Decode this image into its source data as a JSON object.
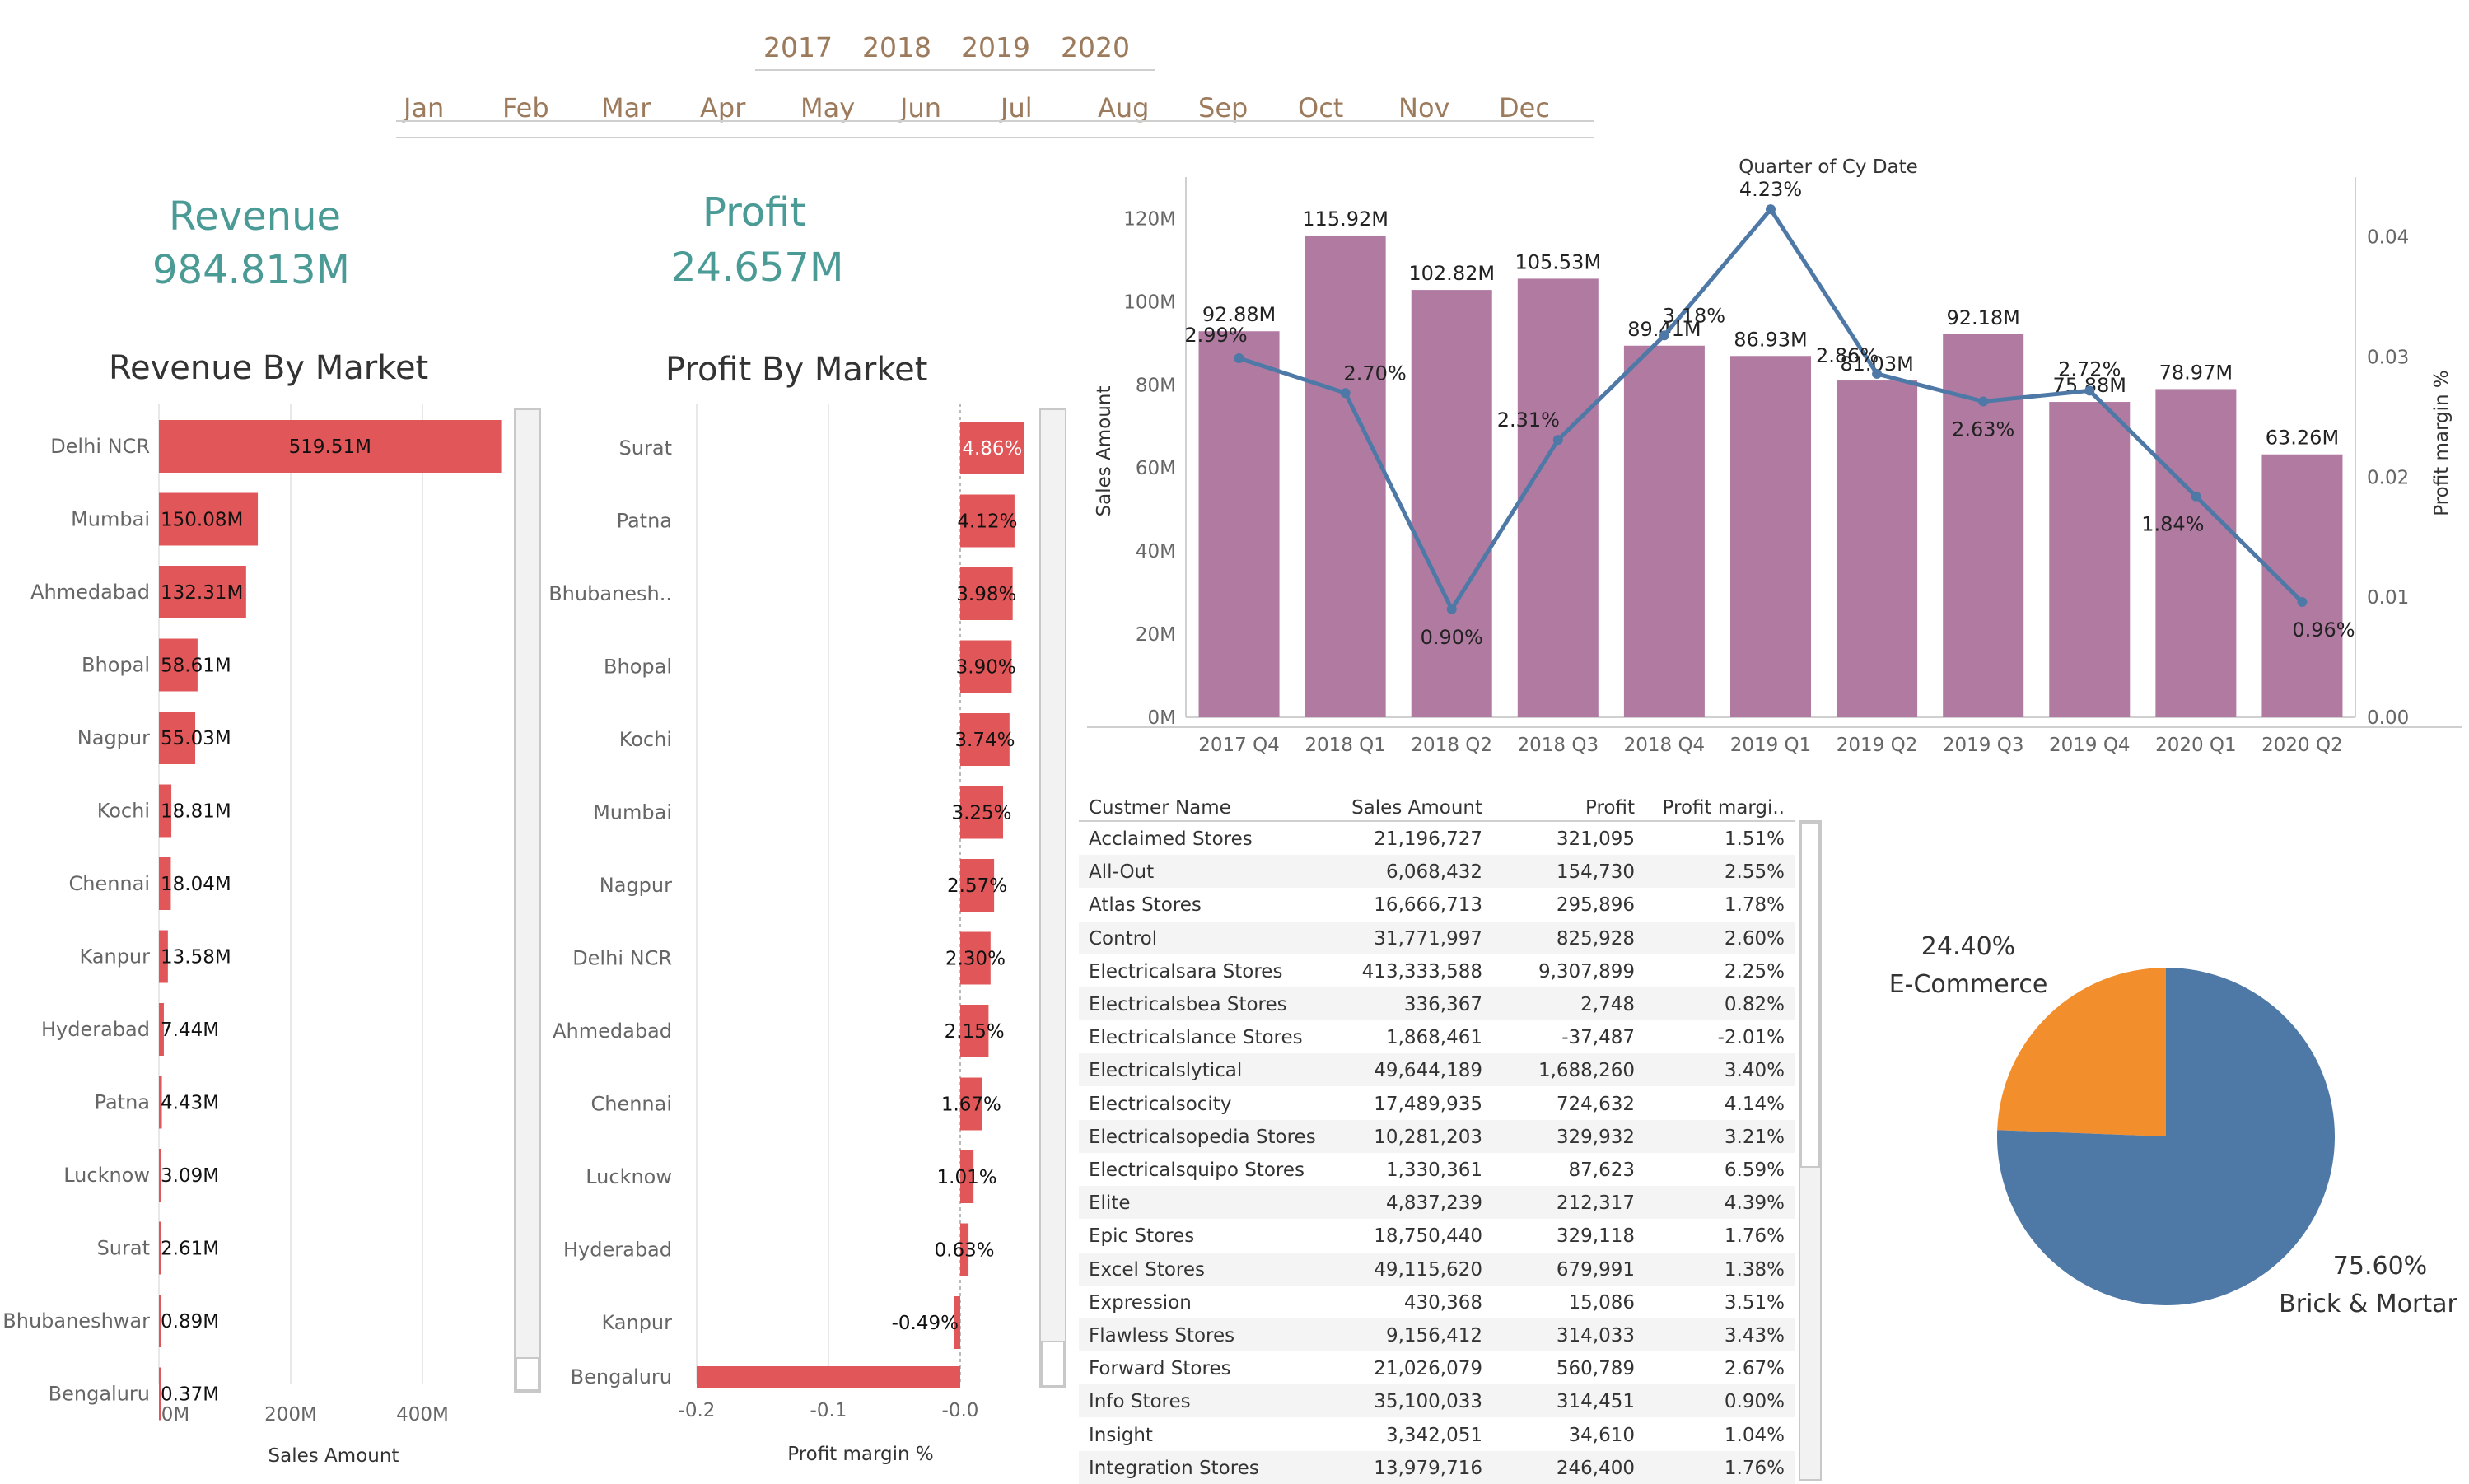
{
  "filters": {
    "years": [
      "2017",
      "2018",
      "2019",
      "2020"
    ],
    "months": [
      "Jan",
      "Feb",
      "Mar",
      "Apr",
      "May",
      "Jun",
      "Jul",
      "Aug",
      "Sep",
      "Oct",
      "Nov",
      "Dec"
    ]
  },
  "kpis": {
    "revenue_label": "Revenue",
    "revenue_value": "984.813M",
    "profit_label": "Profit",
    "profit_value": "24.657M"
  },
  "colors": {
    "bar_red": "#e15759",
    "bar_purple": "#b07aa1",
    "line_blue": "#4e79a7",
    "pie_orange": "#f28e2b",
    "pie_blue": "#4e79a7",
    "kpi_teal": "#4a9a96"
  },
  "chart_data": [
    {
      "type": "bar",
      "title": "Revenue By Market",
      "xlabel": "Sales Amount",
      "orientation": "horizontal",
      "categories": [
        "Delhi NCR",
        "Mumbai",
        "Ahmedabad",
        "Bhopal",
        "Nagpur",
        "Kochi",
        "Chennai",
        "Kanpur",
        "Hyderabad",
        "Patna",
        "Lucknow",
        "Surat",
        "Bhubaneshwar",
        "Bengaluru"
      ],
      "values": [
        519.51,
        150.08,
        132.31,
        58.61,
        55.03,
        18.81,
        18.04,
        13.58,
        7.44,
        4.43,
        3.09,
        2.61,
        0.89,
        0.37
      ],
      "labels": [
        "519.51M",
        "150.08M",
        "132.31M",
        "58.61M",
        "55.03M",
        "18.81M",
        "18.04M",
        "13.58M",
        "7.44M",
        "4.43M",
        "3.09M",
        "2.61M",
        "0.89M",
        "0.37M"
      ],
      "xlim": [
        0,
        560
      ],
      "xticks": [
        "0M",
        "200M",
        "400M"
      ],
      "xtick_values": [
        0,
        200,
        400
      ]
    },
    {
      "type": "bar",
      "title": "Profit By Market",
      "xlabel": "Profit margin %",
      "orientation": "horizontal",
      "categories": [
        "Surat",
        "Patna",
        "Bhubanesh..",
        "Bhopal",
        "Kochi",
        "Mumbai",
        "Nagpur",
        "Delhi NCR",
        "Ahmedabad",
        "Chennai",
        "Lucknow",
        "Hyderabad",
        "Kanpur",
        "Bengaluru"
      ],
      "values": [
        0.0486,
        0.0412,
        0.0398,
        0.039,
        0.0374,
        0.0325,
        0.0257,
        0.023,
        0.0215,
        0.0167,
        0.0101,
        0.0063,
        -0.0049,
        -0.2
      ],
      "labels": [
        "4.86%",
        "4.12%",
        "3.98%",
        "3.90%",
        "3.74%",
        "3.25%",
        "2.57%",
        "2.30%",
        "2.15%",
        "1.67%",
        "1.01%",
        "0.63%",
        "-0.49%",
        ""
      ],
      "xlim": [
        -0.23,
        0.055
      ],
      "xticks": [
        "-0.2",
        "-0.1",
        "-0.0"
      ],
      "xtick_values": [
        -0.2,
        -0.1,
        0
      ]
    },
    {
      "type": "bar",
      "title": "Quarter of Cy Date",
      "ylabel": "Sales Amount",
      "y2label": "Profit margin %",
      "categories": [
        "2017 Q4",
        "2018 Q1",
        "2018 Q2",
        "2018 Q3",
        "2018 Q4",
        "2019 Q1",
        "2019 Q2",
        "2019 Q3",
        "2019 Q4",
        "2020 Q1",
        "2020 Q2"
      ],
      "series": [
        {
          "name": "Sales Amount",
          "kind": "bar",
          "values": [
            92.88,
            115.92,
            102.82,
            105.53,
            89.41,
            86.93,
            81.03,
            92.18,
            75.88,
            78.97,
            63.26
          ],
          "labels": [
            "92.88M",
            "115.92M",
            "102.82M",
            "105.53M",
            "89.41M",
            "86.93M",
            "81.03M",
            "92.18M",
            "75.88M",
            "78.97M",
            "63.26M"
          ]
        },
        {
          "name": "Profit margin %",
          "kind": "line",
          "values": [
            0.0299,
            0.027,
            0.009,
            0.0231,
            0.0318,
            0.0423,
            0.0286,
            0.0263,
            0.0272,
            0.0184,
            0.0096
          ],
          "labels": [
            "2.99%",
            "2.70%",
            "0.90%",
            "2.31%",
            "3.18%",
            "4.23%",
            "2.86%",
            "2.63%",
            "2.72%",
            "1.84%",
            "0.96%"
          ]
        }
      ],
      "ylim": [
        0,
        128
      ],
      "yticks": [
        "0M",
        "20M",
        "40M",
        "60M",
        "80M",
        "100M",
        "120M"
      ],
      "ytick_values": [
        0,
        20,
        40,
        60,
        80,
        100,
        120
      ],
      "y2lim": [
        0,
        0.0443
      ],
      "y2ticks": [
        "0.00",
        "0.01",
        "0.02",
        "0.03",
        "0.04"
      ],
      "y2tick_values": [
        0,
        0.01,
        0.02,
        0.03,
        0.04
      ]
    },
    {
      "type": "pie",
      "slices": [
        {
          "name": "E-Commerce",
          "value": 24.4,
          "label": "24.40%"
        },
        {
          "name": "Brick & Mortar",
          "value": 75.6,
          "label": "75.60%"
        }
      ]
    }
  ],
  "table": {
    "headers": [
      "Custmer Name",
      "Sales Amount",
      "Profit",
      "Profit margi.."
    ],
    "rows": [
      [
        "Acclaimed Stores",
        "21,196,727",
        "321,095",
        "1.51%"
      ],
      [
        "All-Out",
        "6,068,432",
        "154,730",
        "2.55%"
      ],
      [
        "Atlas Stores",
        "16,666,713",
        "295,896",
        "1.78%"
      ],
      [
        "Control",
        "31,771,997",
        "825,928",
        "2.60%"
      ],
      [
        "Electricalsara Stores",
        "413,333,588",
        "9,307,899",
        "2.25%"
      ],
      [
        "Electricalsbea Stores",
        "336,367",
        "2,748",
        "0.82%"
      ],
      [
        "Electricalslance Stores",
        "1,868,461",
        "-37,487",
        "-2.01%"
      ],
      [
        "Electricalslytical",
        "49,644,189",
        "1,688,260",
        "3.40%"
      ],
      [
        "Electricalsocity",
        "17,489,935",
        "724,632",
        "4.14%"
      ],
      [
        "Electricalsopedia Stores",
        "10,281,203",
        "329,932",
        "3.21%"
      ],
      [
        "Electricalsquipo Stores",
        "1,330,361",
        "87,623",
        "6.59%"
      ],
      [
        "Elite",
        "4,837,239",
        "212,317",
        "4.39%"
      ],
      [
        "Epic Stores",
        "18,750,440",
        "329,118",
        "1.76%"
      ],
      [
        "Excel Stores",
        "49,115,620",
        "679,991",
        "1.38%"
      ],
      [
        "Expression",
        "430,368",
        "15,086",
        "3.51%"
      ],
      [
        "Flawless Stores",
        "9,156,412",
        "314,033",
        "3.43%"
      ],
      [
        "Forward Stores",
        "21,026,079",
        "560,789",
        "2.67%"
      ],
      [
        "Info Stores",
        "35,100,033",
        "314,451",
        "0.90%"
      ],
      [
        "Insight",
        "3,342,051",
        "34,610",
        "1.04%"
      ],
      [
        "Integration Stores",
        "13,979,716",
        "246,400",
        "1.76%"
      ]
    ]
  }
}
